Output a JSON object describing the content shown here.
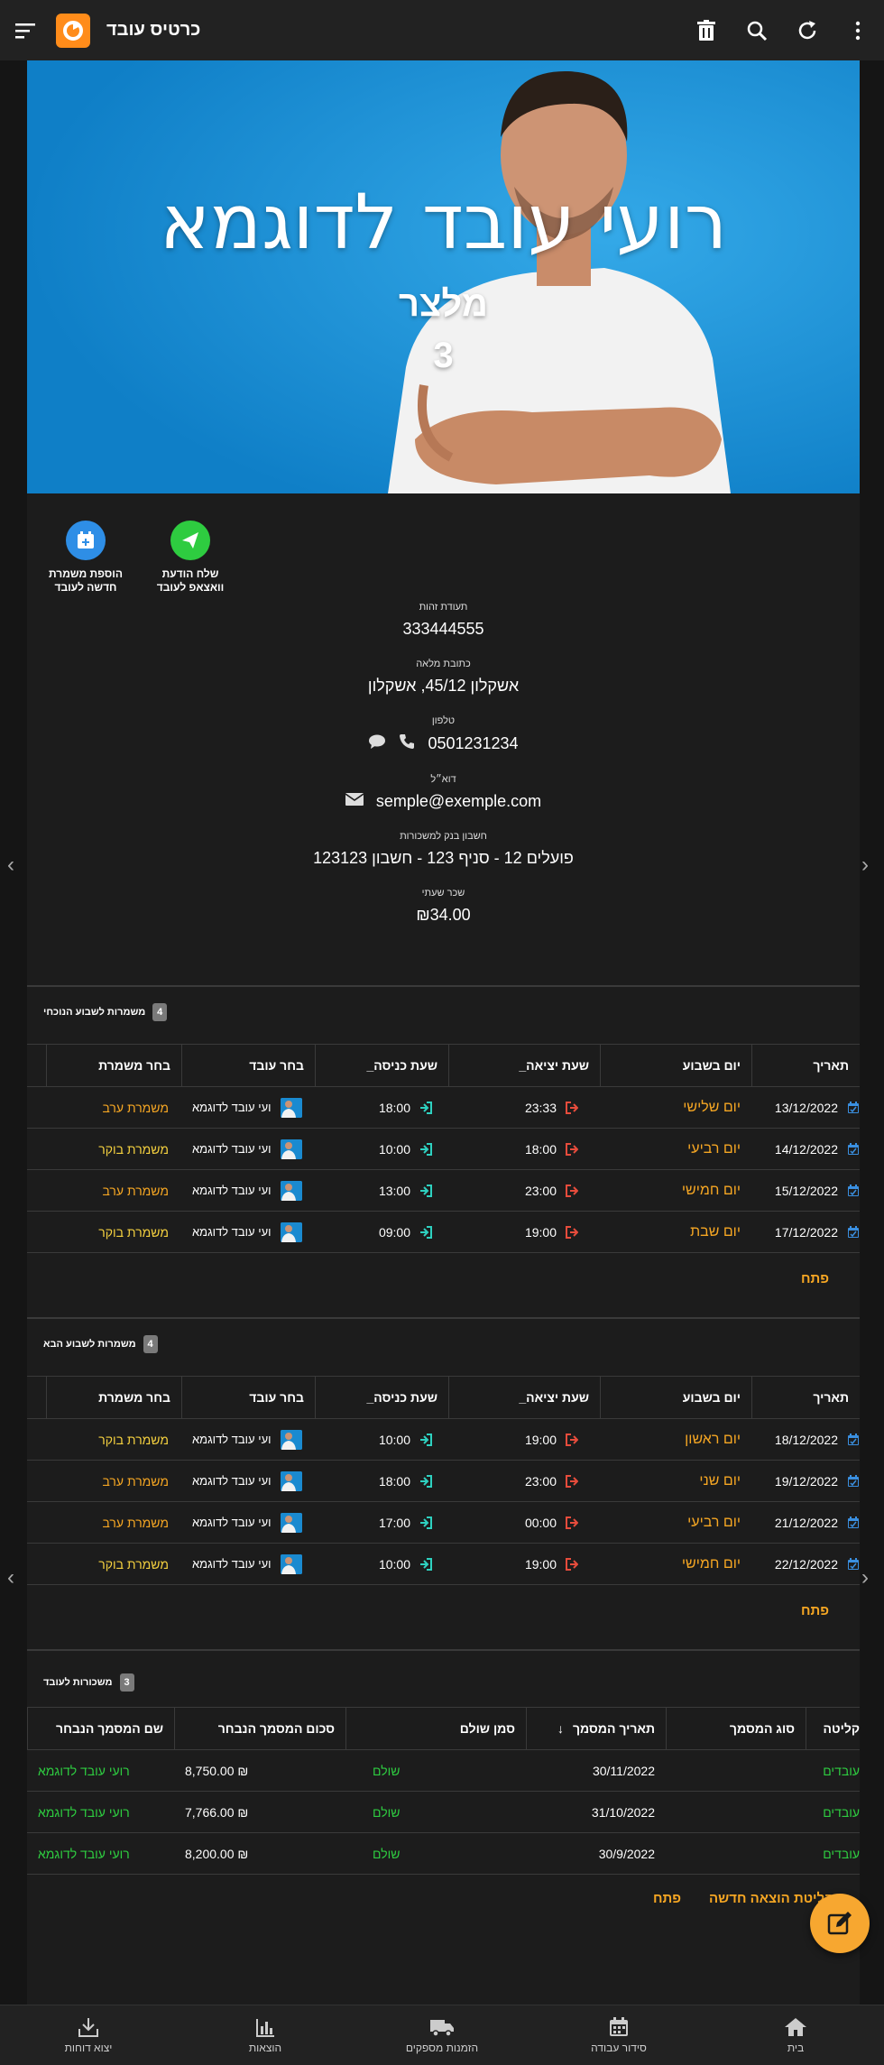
{
  "app": {
    "title": "כרטיס עובד"
  },
  "hero": {
    "name": "רועי עובד לדוגמא",
    "role": "מלצר",
    "number": "3"
  },
  "actions": [
    {
      "label1": "שלח הודעת",
      "label2": "וואצאפ לעובד",
      "color": "#2ecc40",
      "icon": "send-icon"
    },
    {
      "label1": "הוספת משמרת",
      "label2": "חדשה לעובד",
      "color": "#2e8ee6",
      "icon": "calendar-plus-icon"
    }
  ],
  "info": {
    "id_label": "תעודת זהות",
    "id_value": "333444555",
    "address_label": "כתובת מלאה",
    "address_value": "אשקלון 45/12, אשקלון",
    "phone_label": "טלפון",
    "phone_value": "0501231234",
    "email_label": "דוא״ל",
    "email_value": "semple@exemple.com",
    "bank_label": "חשבון בנק למשכורות",
    "bank_value": "פועלים 12 - סניף 123 - חשבון 123123",
    "wage_label": "שכר שעתי",
    "wage_value": "₪34.00"
  },
  "current_week": {
    "title": "משמרות לשבוע הנוכחי",
    "count": "4",
    "headers": [
      "תאריך",
      "יום בשבוע",
      "שעת יציאה_",
      "שעת כניסה_",
      "בחר עובד",
      "בחר משמרת"
    ],
    "rows": [
      {
        "date": "13/12/2022",
        "day": "יום שלישי",
        "out": "23:33",
        "in": "18:00",
        "employee": "ועי עובד לדוגמא",
        "shift": "משמרת ערב",
        "shift_type": "evening"
      },
      {
        "date": "14/12/2022",
        "day": "יום רביעי",
        "out": "18:00",
        "in": "10:00",
        "employee": "ועי עובד לדוגמא",
        "shift": "משמרת בוקר",
        "shift_type": "morning"
      },
      {
        "date": "15/12/2022",
        "day": "יום חמישי",
        "out": "23:00",
        "in": "13:00",
        "employee": "ועי עובד לדוגמא",
        "shift": "משמרת ערב",
        "shift_type": "evening"
      },
      {
        "date": "17/12/2022",
        "day": "יום שבת",
        "out": "19:00",
        "in": "09:00",
        "employee": "ועי עובד לדוגמא",
        "shift": "משמרת בוקר",
        "shift_type": "morning"
      }
    ],
    "open_label": "פתח"
  },
  "next_week": {
    "title": "משמרות לשבוע הבא",
    "count": "4",
    "headers": [
      "תאריך",
      "יום בשבוע",
      "שעת יציאה_",
      "שעת כניסה_",
      "בחר עובד",
      "בחר משמרת"
    ],
    "rows": [
      {
        "date": "18/12/2022",
        "day": "יום ראשון",
        "out": "19:00",
        "in": "10:00",
        "employee": "ועי עובד לדוגמא",
        "shift": "משמרת בוקר",
        "shift_type": "morning"
      },
      {
        "date": "19/12/2022",
        "day": "יום שני",
        "out": "23:00",
        "in": "18:00",
        "employee": "ועי עובד לדוגמא",
        "shift": "משמרת ערב",
        "shift_type": "evening"
      },
      {
        "date": "21/12/2022",
        "day": "יום רביעי",
        "out": "00:00",
        "in": "17:00",
        "employee": "ועי עובד לדוגמא",
        "shift": "משמרת ערב",
        "shift_type": "evening"
      },
      {
        "date": "22/12/2022",
        "day": "יום חמישי",
        "out": "19:00",
        "in": "10:00",
        "employee": "ועי עובד לדוגמא",
        "shift": "משמרת בוקר",
        "shift_type": "morning"
      }
    ],
    "open_label": "פתח"
  },
  "salaries": {
    "title": "משכורות לעובד",
    "count": "3",
    "headers": [
      "קליטה",
      "סוג המסמך",
      "תאריך המסמך",
      "סמן שולם",
      "סכום המסמך הנבחר",
      "שם המסמך הנבחר"
    ],
    "rows": [
      {
        "kind": "עובדים",
        "doc_type": "",
        "date": "30/11/2022",
        "paid": "שולם",
        "amount": "8,750.00 ₪",
        "name": "רועי עובד לדוגמא"
      },
      {
        "kind": "עובדים",
        "doc_type": "",
        "date": "31/10/2022",
        "paid": "שולם",
        "amount": "7,766.00 ₪",
        "name": "רועי עובד לדוגמא"
      },
      {
        "kind": "עובדים",
        "doc_type": "",
        "date": "30/9/2022",
        "paid": "שולם",
        "amount": "8,200.00 ₪",
        "name": "רועי עובד לדוגמא"
      }
    ],
    "new_expense_label": "קליטת הוצאה חדשה",
    "open_label": "פתח"
  },
  "bottom_nav": [
    {
      "label": "בית",
      "icon": "home-icon"
    },
    {
      "label": "סידור עבודה",
      "icon": "calendar-icon"
    },
    {
      "label": "הזמנות מספקים",
      "icon": "truck-icon"
    },
    {
      "label": "הוצאות",
      "icon": "bar-chart-icon"
    },
    {
      "label": "יצוא דוחות",
      "icon": "download-icon"
    }
  ],
  "colors": {
    "accent": "#f5a623",
    "morning": "#f4d03f",
    "evening": "#f5a623",
    "paid": "#2ecc40"
  }
}
